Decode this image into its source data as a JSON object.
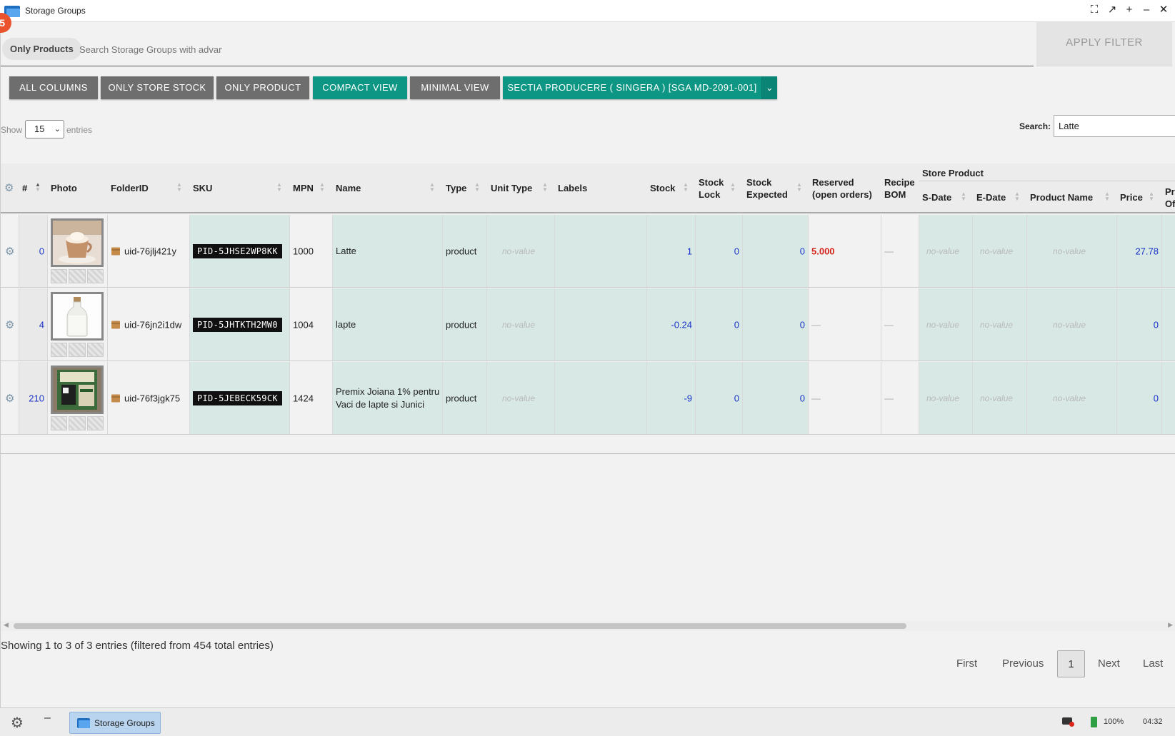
{
  "window": {
    "title": "Storage Groups",
    "badge": "5"
  },
  "filter": {
    "chip": "Only Products",
    "placeholder": "Search Storage Groups with advanced",
    "apply_label": "APPLY FILTER"
  },
  "toolbar": {
    "all_columns": "ALL COLUMNS",
    "only_store_stock": "ONLY STORE STOCK",
    "only_product": "ONLY PRODUCT",
    "compact_view": "COMPACT VIEW",
    "minimal_view": "MINIMAL VIEW",
    "storage_select": "SECTIA PRODUCERE ( SINGERA ) [SGA MD-2091-001]"
  },
  "length": {
    "show": "Show",
    "value": "15",
    "entries": "entries"
  },
  "search": {
    "label": "Search:",
    "value": "Latte"
  },
  "columns": {
    "num": "#",
    "photo": "Photo",
    "folder": "FolderID",
    "sku": "SKU",
    "mpn": "MPN",
    "name": "Name",
    "type": "Type",
    "unit_type": "Unit Type",
    "labels": "Labels",
    "stock": "Stock",
    "stock_lock_1": "Stock",
    "stock_lock_2": "Lock",
    "stock_expected_1": "Stock",
    "stock_expected_2": "Expected",
    "reserved_1": "Reserved",
    "reserved_2": "(open orders)",
    "recipe_1": "Recipe",
    "recipe_2": "BOM",
    "store_product": "Store Product",
    "sdate": "S-Date",
    "edate": "E-Date",
    "product_name": "Product Name",
    "price": "Price",
    "pr_1": "Pr",
    "pr_2": "Of"
  },
  "rows": [
    {
      "num": "0",
      "folder": "uid-76jlj421y",
      "sku": "PID-5JHSE2WP8KK",
      "mpn": "1000",
      "name": "Latte",
      "type": "product",
      "unit_type": "no-value",
      "stock": "1",
      "stock_lock": "0",
      "stock_expected": "0",
      "reserved": "5.000",
      "recipe": "—",
      "sdate": "no-value",
      "edate": "no-value",
      "product_name": "no-value",
      "price": "27.78"
    },
    {
      "num": "4",
      "folder": "uid-76jn2i1dw",
      "sku": "PID-5JHTKTH2MW0",
      "mpn": "1004",
      "name": "lapte",
      "type": "product",
      "unit_type": "no-value",
      "stock": "-0.24",
      "stock_lock": "0",
      "stock_expected": "0",
      "reserved": "—",
      "recipe": "—",
      "sdate": "no-value",
      "edate": "no-value",
      "product_name": "no-value",
      "price": "0"
    },
    {
      "num": "210",
      "folder": "uid-76f3jgk75",
      "sku": "PID-5JEBECK59CK",
      "mpn": "1424",
      "name": "Premix Joiana 1% pentru Vaci de lapte si Junici",
      "type": "product",
      "unit_type": "no-value",
      "stock": "-9",
      "stock_lock": "0",
      "stock_expected": "0",
      "reserved": "—",
      "recipe": "—",
      "sdate": "no-value",
      "edate": "no-value",
      "product_name": "no-value",
      "price": "0"
    }
  ],
  "footer": {
    "info": "Showing 1 to 3 of 3 entries (filtered from 454 total entries)",
    "first": "First",
    "previous": "Previous",
    "page": "1",
    "next": "Next",
    "last": "Last"
  },
  "taskbar": {
    "app_label": "Storage Groups",
    "battery": "100%",
    "time": "04:32"
  },
  "colors": {
    "teal": "#0c9683",
    "grey_button": "#6e6e6e",
    "link_blue": "#1a34c8",
    "reserved_red": "#d4261b"
  }
}
